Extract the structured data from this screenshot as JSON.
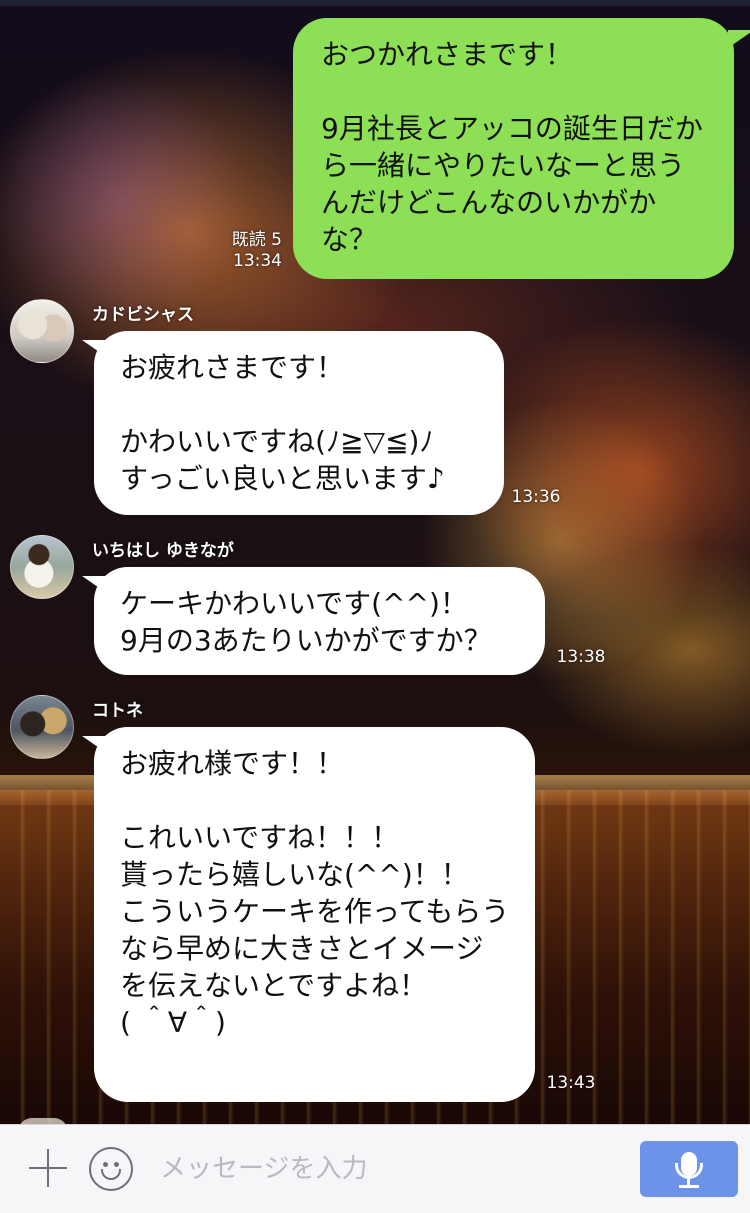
{
  "colors": {
    "my_bubble": "#8de055",
    "other_bubble": "#ffffff",
    "send_button": "#6c93e8"
  },
  "messages": [
    {
      "from": "me",
      "text": "おつかれさまです！\n\n9月社長とアッコの誕生日だから一緒にやりたいなーと思うんだけどこんなのいかがかな？",
      "read": "既読 5",
      "time": "13:34"
    },
    {
      "from": "other",
      "sender": "カドビシャス",
      "text": "お疲れさまです！\n\nかわいいですね(ﾉ≧▽≦)ﾉ\nすっごい良いと思います♪",
      "time": "13:36"
    },
    {
      "from": "other",
      "sender": "いちはし ゆきなが",
      "text": "ケーキかわいいです(^^)！\n9月の3あたりいかがですか？",
      "time": "13:38"
    },
    {
      "from": "other",
      "sender": "コトネ",
      "text": "お疲れ様です！！\n\nこれいいですね！！！\n貰ったら嬉しいな(^^)！！\nこういうケーキを作ってもらうなら早めに大きさとイメージを伝えないとですよね！\n( ＾∀＾)",
      "time": "13:43"
    }
  ],
  "input_bar": {
    "add_icon": "plus-icon",
    "emoji_icon": "smiley-icon",
    "placeholder": "メッセージを入力",
    "voice_icon": "microphone-icon"
  }
}
